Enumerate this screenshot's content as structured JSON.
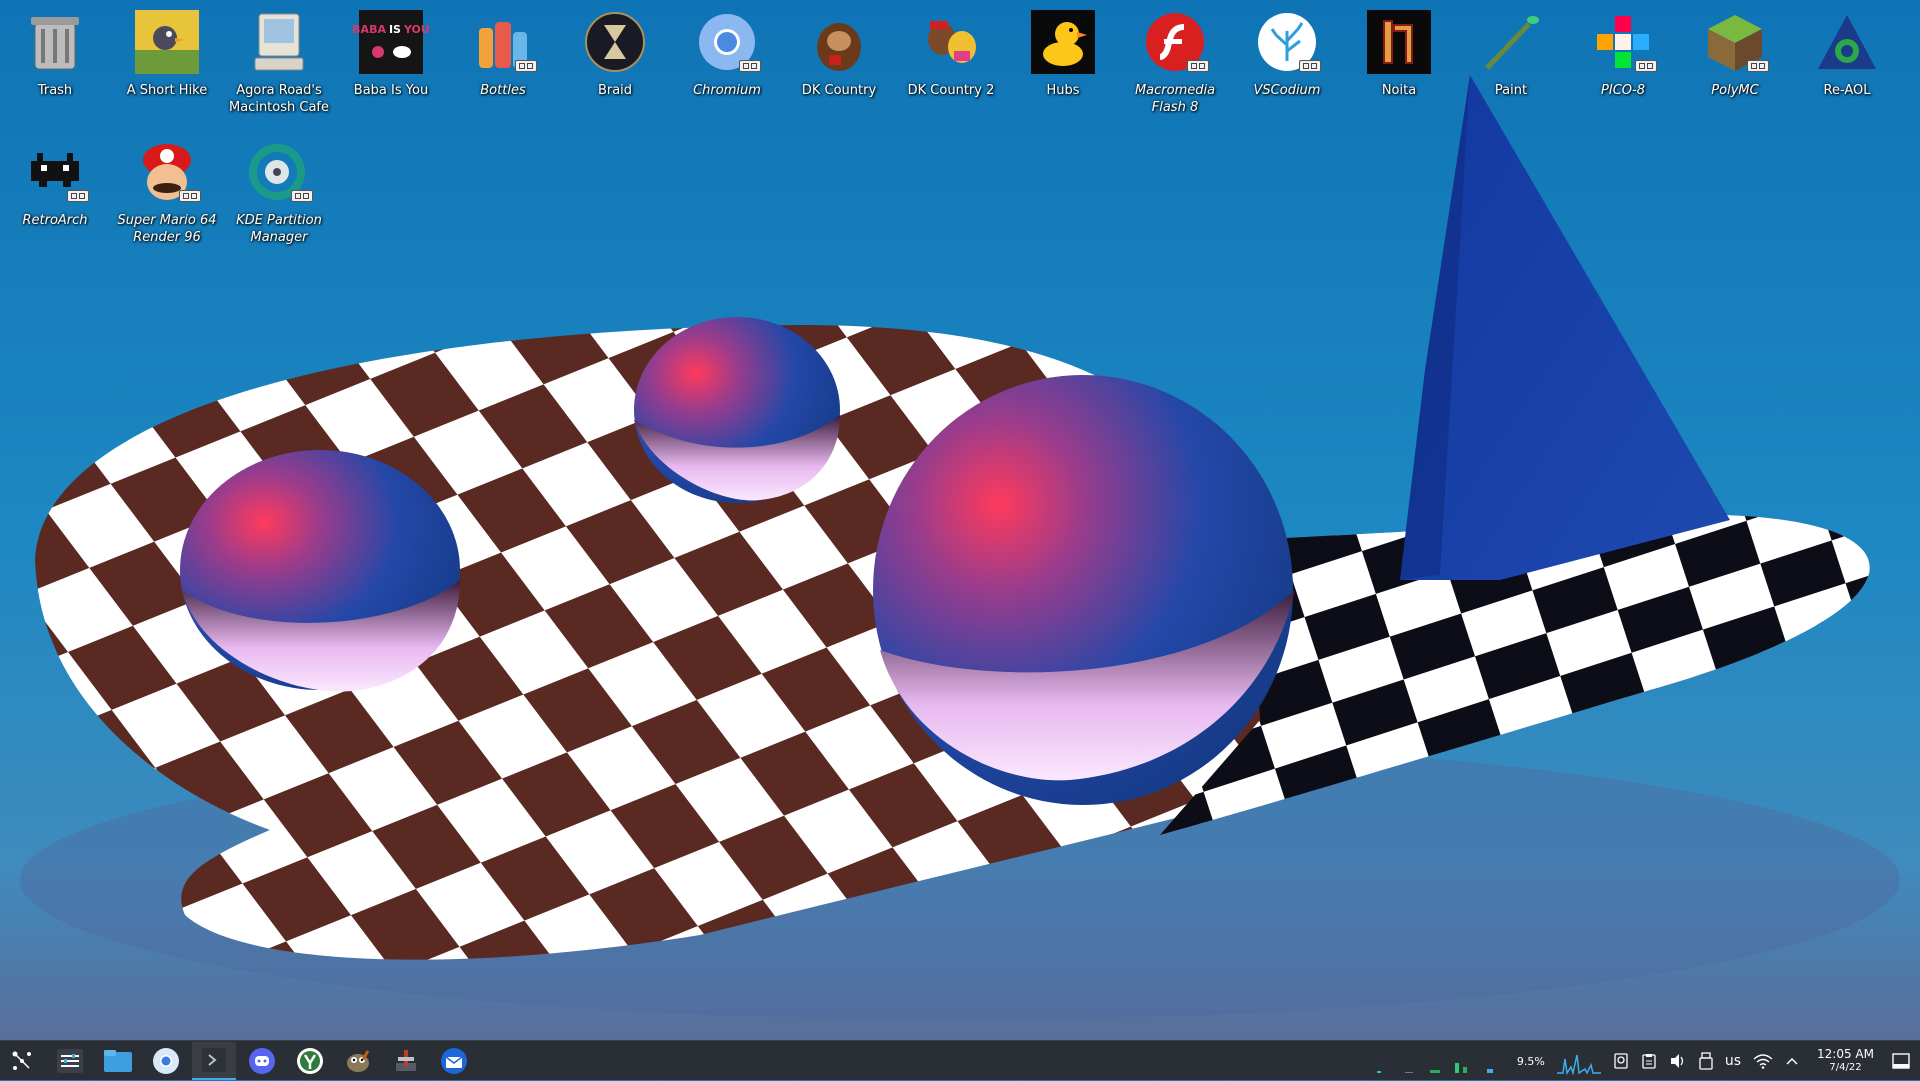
{
  "desktop_icons": [
    {
      "name": "trash",
      "label": "Trash",
      "link": false
    },
    {
      "name": "a-short-hike",
      "label": "A Short Hike",
      "link": false
    },
    {
      "name": "agora-road",
      "label": "Agora Road's Macintosh Cafe",
      "link": false
    },
    {
      "name": "baba-is-you",
      "label": "Baba Is You",
      "link": false
    },
    {
      "name": "bottles",
      "label": "Bottles",
      "link": true
    },
    {
      "name": "braid",
      "label": "Braid",
      "link": false
    },
    {
      "name": "chromium",
      "label": "Chromium",
      "link": true
    },
    {
      "name": "dk-country",
      "label": "DK Country",
      "link": false
    },
    {
      "name": "dk-country-2",
      "label": "DK Country 2",
      "link": false
    },
    {
      "name": "hubs",
      "label": "Hubs",
      "link": false
    },
    {
      "name": "macromedia-flash",
      "label": "Macromedia Flash 8",
      "link": true
    },
    {
      "name": "vscodium",
      "label": "VSCodium",
      "link": true
    },
    {
      "name": "noita",
      "label": "Noita",
      "link": false
    },
    {
      "name": "paint",
      "label": "Paint",
      "link": false
    },
    {
      "name": "pico-8",
      "label": "PICO-8",
      "link": true
    },
    {
      "name": "polymc",
      "label": "PolyMC",
      "link": true
    },
    {
      "name": "re-aol",
      "label": "Re-AOL",
      "link": false
    },
    {
      "name": "retroarch",
      "label": "RetroArch",
      "link": true
    },
    {
      "name": "super-mario-64",
      "label": "Super Mario 64 Render 96",
      "link": true
    },
    {
      "name": "kde-partition-manager",
      "label": "KDE Partition Manager",
      "link": true
    }
  ],
  "baba_logo": {
    "line1": "BABA",
    "line2": "IS",
    "line3": "YOU"
  },
  "taskbar": {
    "cpu_percent": "9.5%",
    "keyboard_layout": "us",
    "time": "12:05 AM",
    "date": "7/4/22"
  },
  "colors": {
    "taskbar": "#2a2e35",
    "accent": "#3daee9",
    "checker_dark": "#5a2a22",
    "sphere_blue": "#1c4fa8"
  }
}
